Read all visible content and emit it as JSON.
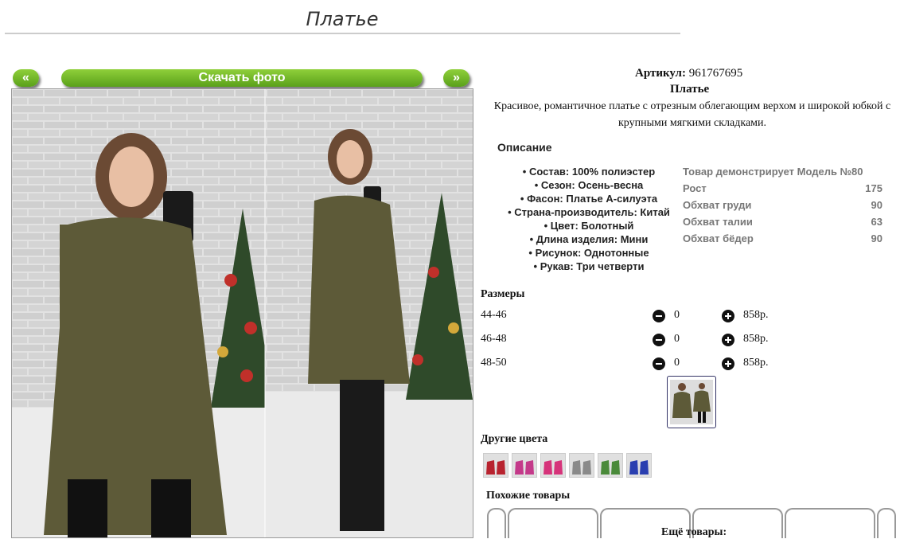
{
  "page": {
    "title": "Платье"
  },
  "gallery": {
    "prev_label": "«",
    "next_label": "»",
    "download_label": "Скачать фото"
  },
  "product": {
    "sku_label": "Артикул:",
    "sku_value": "961767695",
    "name": "Платье",
    "description": "Красивое, романтичное платье с отрезным облегающим верхом и широкой юбкой с крупными мягкими складками.",
    "description_heading": "Описание",
    "attributes": [
      "Состав: 100% полиэстер",
      "Сезон: Осень-весна",
      "Фасон: Платье А-силуэта",
      "Страна-производитель: Китай",
      "Цвет: Болотный",
      "Длина изделия: Мини",
      "Рисунок: Однотонные",
      "Рукав: Три четверти"
    ],
    "model": {
      "heading": "Товар демонстрирует Модель №80",
      "rows": [
        {
          "label": "Рост",
          "value": "175"
        },
        {
          "label": "Обхват груди",
          "value": "90"
        },
        {
          "label": "Обхват талии",
          "value": "63"
        },
        {
          "label": "Обхват бёдер",
          "value": "90"
        }
      ]
    }
  },
  "sizes": {
    "heading": "Размеры",
    "rows": [
      {
        "size": "44-46",
        "qty": "0",
        "price": "858р."
      },
      {
        "size": "46-48",
        "qty": "0",
        "price": "858р."
      },
      {
        "size": "48-50",
        "qty": "0",
        "price": "858р."
      }
    ]
  },
  "other_colors": {
    "heading": "Другие цвета",
    "swatches": [
      "#b8232f",
      "#c43a8a",
      "#d6337a",
      "#8a8a8a",
      "#4a8a3a",
      "#2a3fb0"
    ]
  },
  "similar": {
    "heading": "Похожие товары"
  },
  "more": {
    "heading": "Ещё товары:"
  },
  "colors": {
    "accent": "#6cb52a",
    "dress": "#5a5a3a",
    "wall": "#d9d9d9"
  }
}
